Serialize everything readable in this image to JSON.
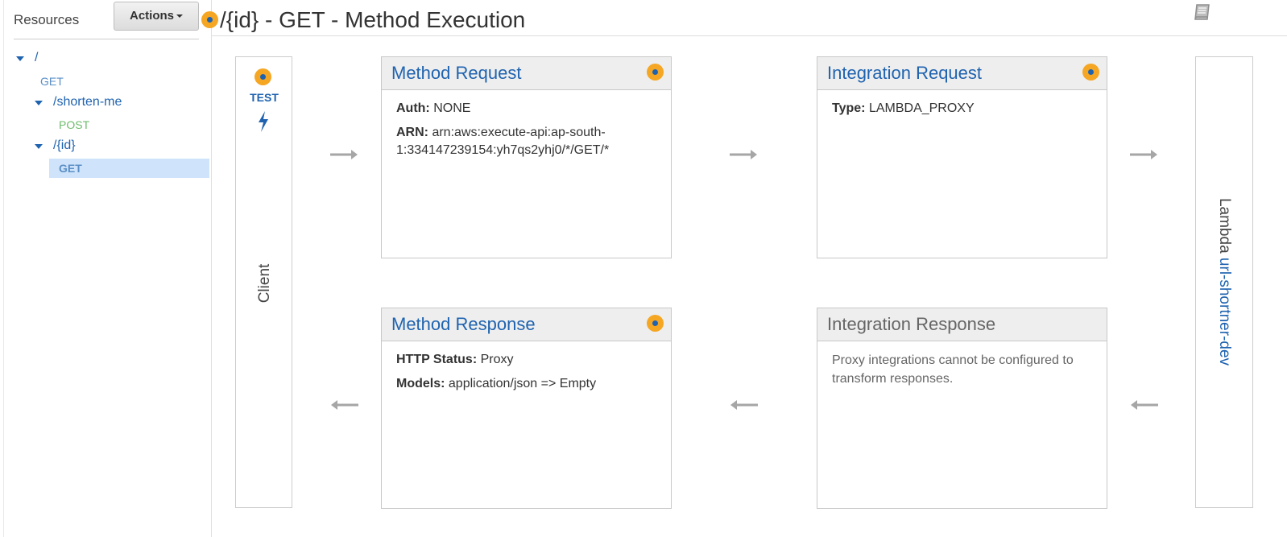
{
  "sidebar": {
    "resources_label": "Resources",
    "actions_label": "Actions",
    "tree": {
      "root": {
        "path": "/",
        "method": "GET"
      },
      "shorten": {
        "path": "/shorten-me",
        "method": "POST"
      },
      "id": {
        "path": "/{id}",
        "method": "GET"
      }
    }
  },
  "header": {
    "title": "/{id} - GET - Method Execution",
    "docs_icon": "book-icon"
  },
  "client": {
    "test_label": "TEST",
    "test_icon": "lightning-bolt-icon",
    "label": "Client"
  },
  "method_request": {
    "title": "Method Request",
    "auth_label": "Auth:",
    "auth_value": "NONE",
    "arn_label": "ARN:",
    "arn_value": "arn:aws:execute-api:ap-south-",
    "arn_value_line2": "1:334147239154:yh7qs2yhj0/*/GET/*"
  },
  "integration_request": {
    "title": "Integration Request",
    "type_label": "Type:",
    "type_value": "LAMBDA_PROXY"
  },
  "method_response": {
    "title": "Method Response",
    "status_label": "HTTP Status:",
    "status_value": "Proxy",
    "models_label": "Models:",
    "models_value": "application/json => Empty"
  },
  "integration_response": {
    "title": "Integration Response",
    "note_line1": "Proxy integrations cannot be configured to",
    "note_line2": "transform responses."
  },
  "lambda": {
    "prefix": "Lambda",
    "function_name": "url-shortner-dev"
  },
  "colors": {
    "accent_blue": "#1f63b0",
    "dot_orange": "#f5a623",
    "selected_bg": "#cfe4fa",
    "post_green": "#6dbb6d",
    "arrow_grey": "#a6a6a6"
  }
}
